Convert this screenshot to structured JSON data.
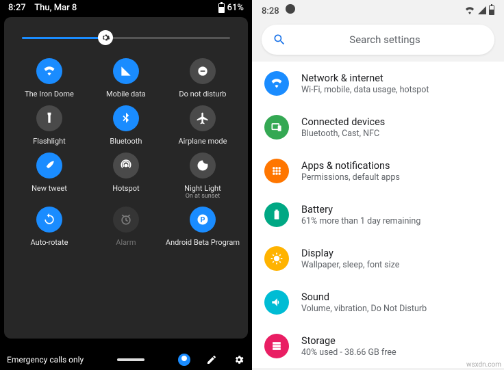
{
  "left": {
    "status": {
      "time": "8:27",
      "date": "Thu, Mar 8",
      "battery": "61%"
    },
    "tiles": [
      {
        "label": "The Iron Dome",
        "on": true,
        "icon": "wifi"
      },
      {
        "label": "Mobile data",
        "on": true,
        "icon": "signal"
      },
      {
        "label": "Do not disturb",
        "on": false,
        "icon": "dnd"
      },
      {
        "label": "Flashlight",
        "on": false,
        "icon": "flashlight"
      },
      {
        "label": "Bluetooth",
        "on": true,
        "icon": "bluetooth"
      },
      {
        "label": "Airplane mode",
        "on": false,
        "icon": "airplane"
      },
      {
        "label": "New tweet",
        "on": true,
        "icon": "feather"
      },
      {
        "label": "Hotspot",
        "on": false,
        "icon": "hotspot"
      },
      {
        "label": "Night Light",
        "sub": "On at sunset",
        "on": false,
        "icon": "moon"
      },
      {
        "label": "Auto-rotate",
        "on": true,
        "icon": "rotate"
      },
      {
        "label": "Alarm",
        "on": false,
        "icon": "alarm",
        "dim": true
      },
      {
        "label": "Android Beta Program",
        "on": true,
        "icon": "p"
      }
    ],
    "bottom": {
      "status_text": "Emergency calls only"
    }
  },
  "right": {
    "status": {
      "time": "8:28"
    },
    "search": {
      "placeholder": "Search settings"
    },
    "items": [
      {
        "title": "Network & internet",
        "sub": "Wi-Fi, mobile, data usage, hotspot",
        "color": "#1a8cff",
        "icon": "wifi"
      },
      {
        "title": "Connected devices",
        "sub": "Bluetooth, Cast, NFC",
        "color": "#34a853",
        "icon": "devices"
      },
      {
        "title": "Apps & notifications",
        "sub": "Permissions, default apps",
        "color": "#ff7600",
        "icon": "apps"
      },
      {
        "title": "Battery",
        "sub": "61% more than 1 day remaining",
        "color": "#00a884",
        "icon": "battery"
      },
      {
        "title": "Display",
        "sub": "Wallpaper, sleep, font size",
        "color": "#ffb300",
        "icon": "display"
      },
      {
        "title": "Sound",
        "sub": "Volume, vibration, Do Not Disturb",
        "color": "#00bcd4",
        "icon": "sound"
      },
      {
        "title": "Storage",
        "sub": "40% used - 38.66 GB free",
        "color": "#e91e63",
        "icon": "storage"
      }
    ]
  },
  "watermark": "wsxdn.com"
}
